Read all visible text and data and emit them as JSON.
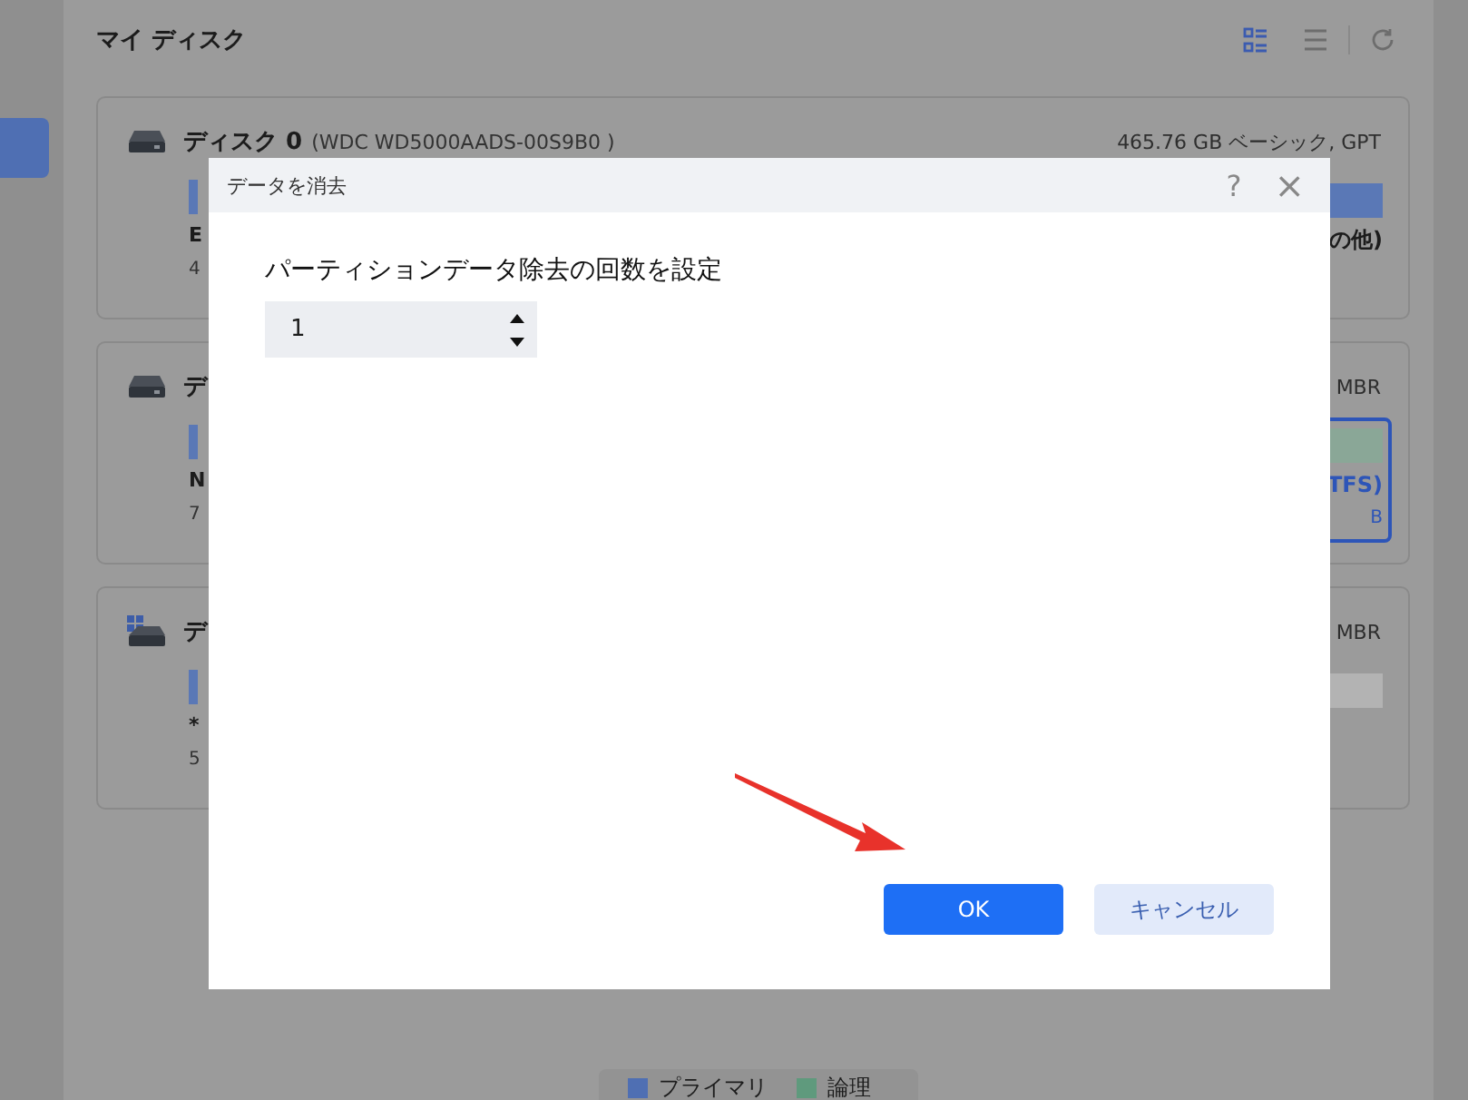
{
  "page_title": "マイ ディスク",
  "views": [
    {
      "kind": "grid",
      "selected": true
    },
    {
      "kind": "list",
      "selected": false
    }
  ],
  "disks": [
    {
      "kind": "drive",
      "name": "ディスク 0",
      "model": "(WDC WD5000AADS-00S9B0 )",
      "info": "465.76 GB ベーシック, GPT",
      "left": {
        "kind": "primary",
        "label": "E",
        "size": "4"
      },
      "right": {
        "kind": "primary",
        "label": "の他)",
        "selected": false
      }
    },
    {
      "kind": "drive",
      "name": "デ",
      "info": "MBR",
      "left": {
        "kind": "primary",
        "label": "N",
        "size": "7"
      },
      "right": {
        "kind": "logical",
        "label": "TFS)",
        "size": "B",
        "selected": true
      }
    },
    {
      "kind": "system",
      "name": "デ",
      "info": "MBR",
      "left": {
        "kind": "primary",
        "label": "*",
        "size": "5"
      },
      "right": {
        "kind": "unallocated",
        "selected": false
      }
    }
  ],
  "legend": [
    {
      "label": "プライマリ",
      "color": "#4f6fb3"
    },
    {
      "label": "論理",
      "color": "#5f9a7d"
    }
  ],
  "dialog": {
    "title": "データを消去",
    "help": "?",
    "close": "×",
    "prompt": "パーティションデータ除去の回数を設定",
    "spinner_value": "1",
    "buttons": [
      {
        "kind": "primary",
        "label": "OK"
      },
      {
        "kind": "secondary",
        "label": "キャンセル"
      }
    ]
  }
}
